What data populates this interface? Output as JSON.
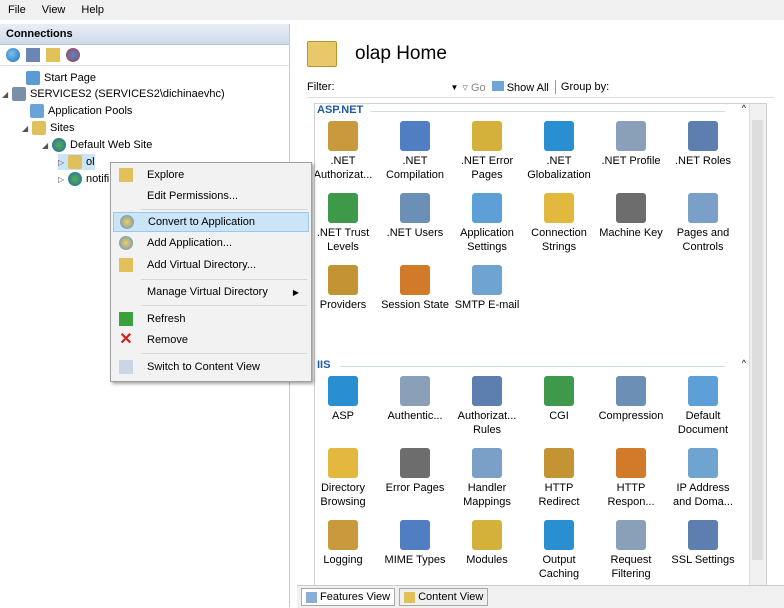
{
  "menubar": {
    "items": [
      "File",
      "View",
      "Help"
    ]
  },
  "connections": {
    "header": "Connections",
    "tree": [
      {
        "label": "Start Page",
        "toggle": ""
      },
      {
        "label": "SERVICES2 (SERVICES2\\dichinaevhc)",
        "toggle": "◢"
      },
      {
        "label": "Application Pools",
        "toggle": ""
      },
      {
        "label": "Sites",
        "toggle": "◢"
      },
      {
        "label": "Default Web Site",
        "toggle": "◢"
      },
      {
        "label": "ol",
        "toggle": "▷"
      },
      {
        "label": "notifi",
        "toggle": "▷"
      }
    ]
  },
  "context_menu": {
    "items": [
      "Explore",
      "Edit Permissions...",
      "Convert to Application",
      "Add Application...",
      "Add Virtual Directory...",
      "Manage Virtual Directory",
      "Refresh",
      "Remove",
      "Switch to Content View"
    ],
    "submenu_arrow": "▶"
  },
  "main": {
    "title": "olap Home",
    "filter_label": "Filter:",
    "go_label": "Go",
    "show_all_label": "Show All",
    "group_by_label": "Group by:",
    "groups": [
      {
        "name": "ASP.NET",
        "features": [
          ".NET Authorizat...",
          ".NET Compilation",
          ".NET Error Pages",
          ".NET Globalization",
          ".NET Profile",
          ".NET Roles",
          ".NET Trust Levels",
          ".NET Users",
          "Application Settings",
          "Connection Strings",
          "Machine Key",
          "Pages and Controls",
          "Providers",
          "Session State",
          "SMTP E-mail"
        ]
      },
      {
        "name": "IIS",
        "features": [
          "ASP",
          "Authentic...",
          "Authorizat... Rules",
          "CGI",
          "Compression",
          "Default Document",
          "Directory Browsing",
          "Error Pages",
          "Handler Mappings",
          "HTTP Redirect",
          "HTTP Respon...",
          "IP Address and Doma...",
          "Logging",
          "MIME Types",
          "Modules",
          "Output Caching",
          "Request Filtering",
          "SSL Settings"
        ]
      }
    ]
  },
  "bottom_tabs": [
    "Features View",
    "Content View"
  ]
}
